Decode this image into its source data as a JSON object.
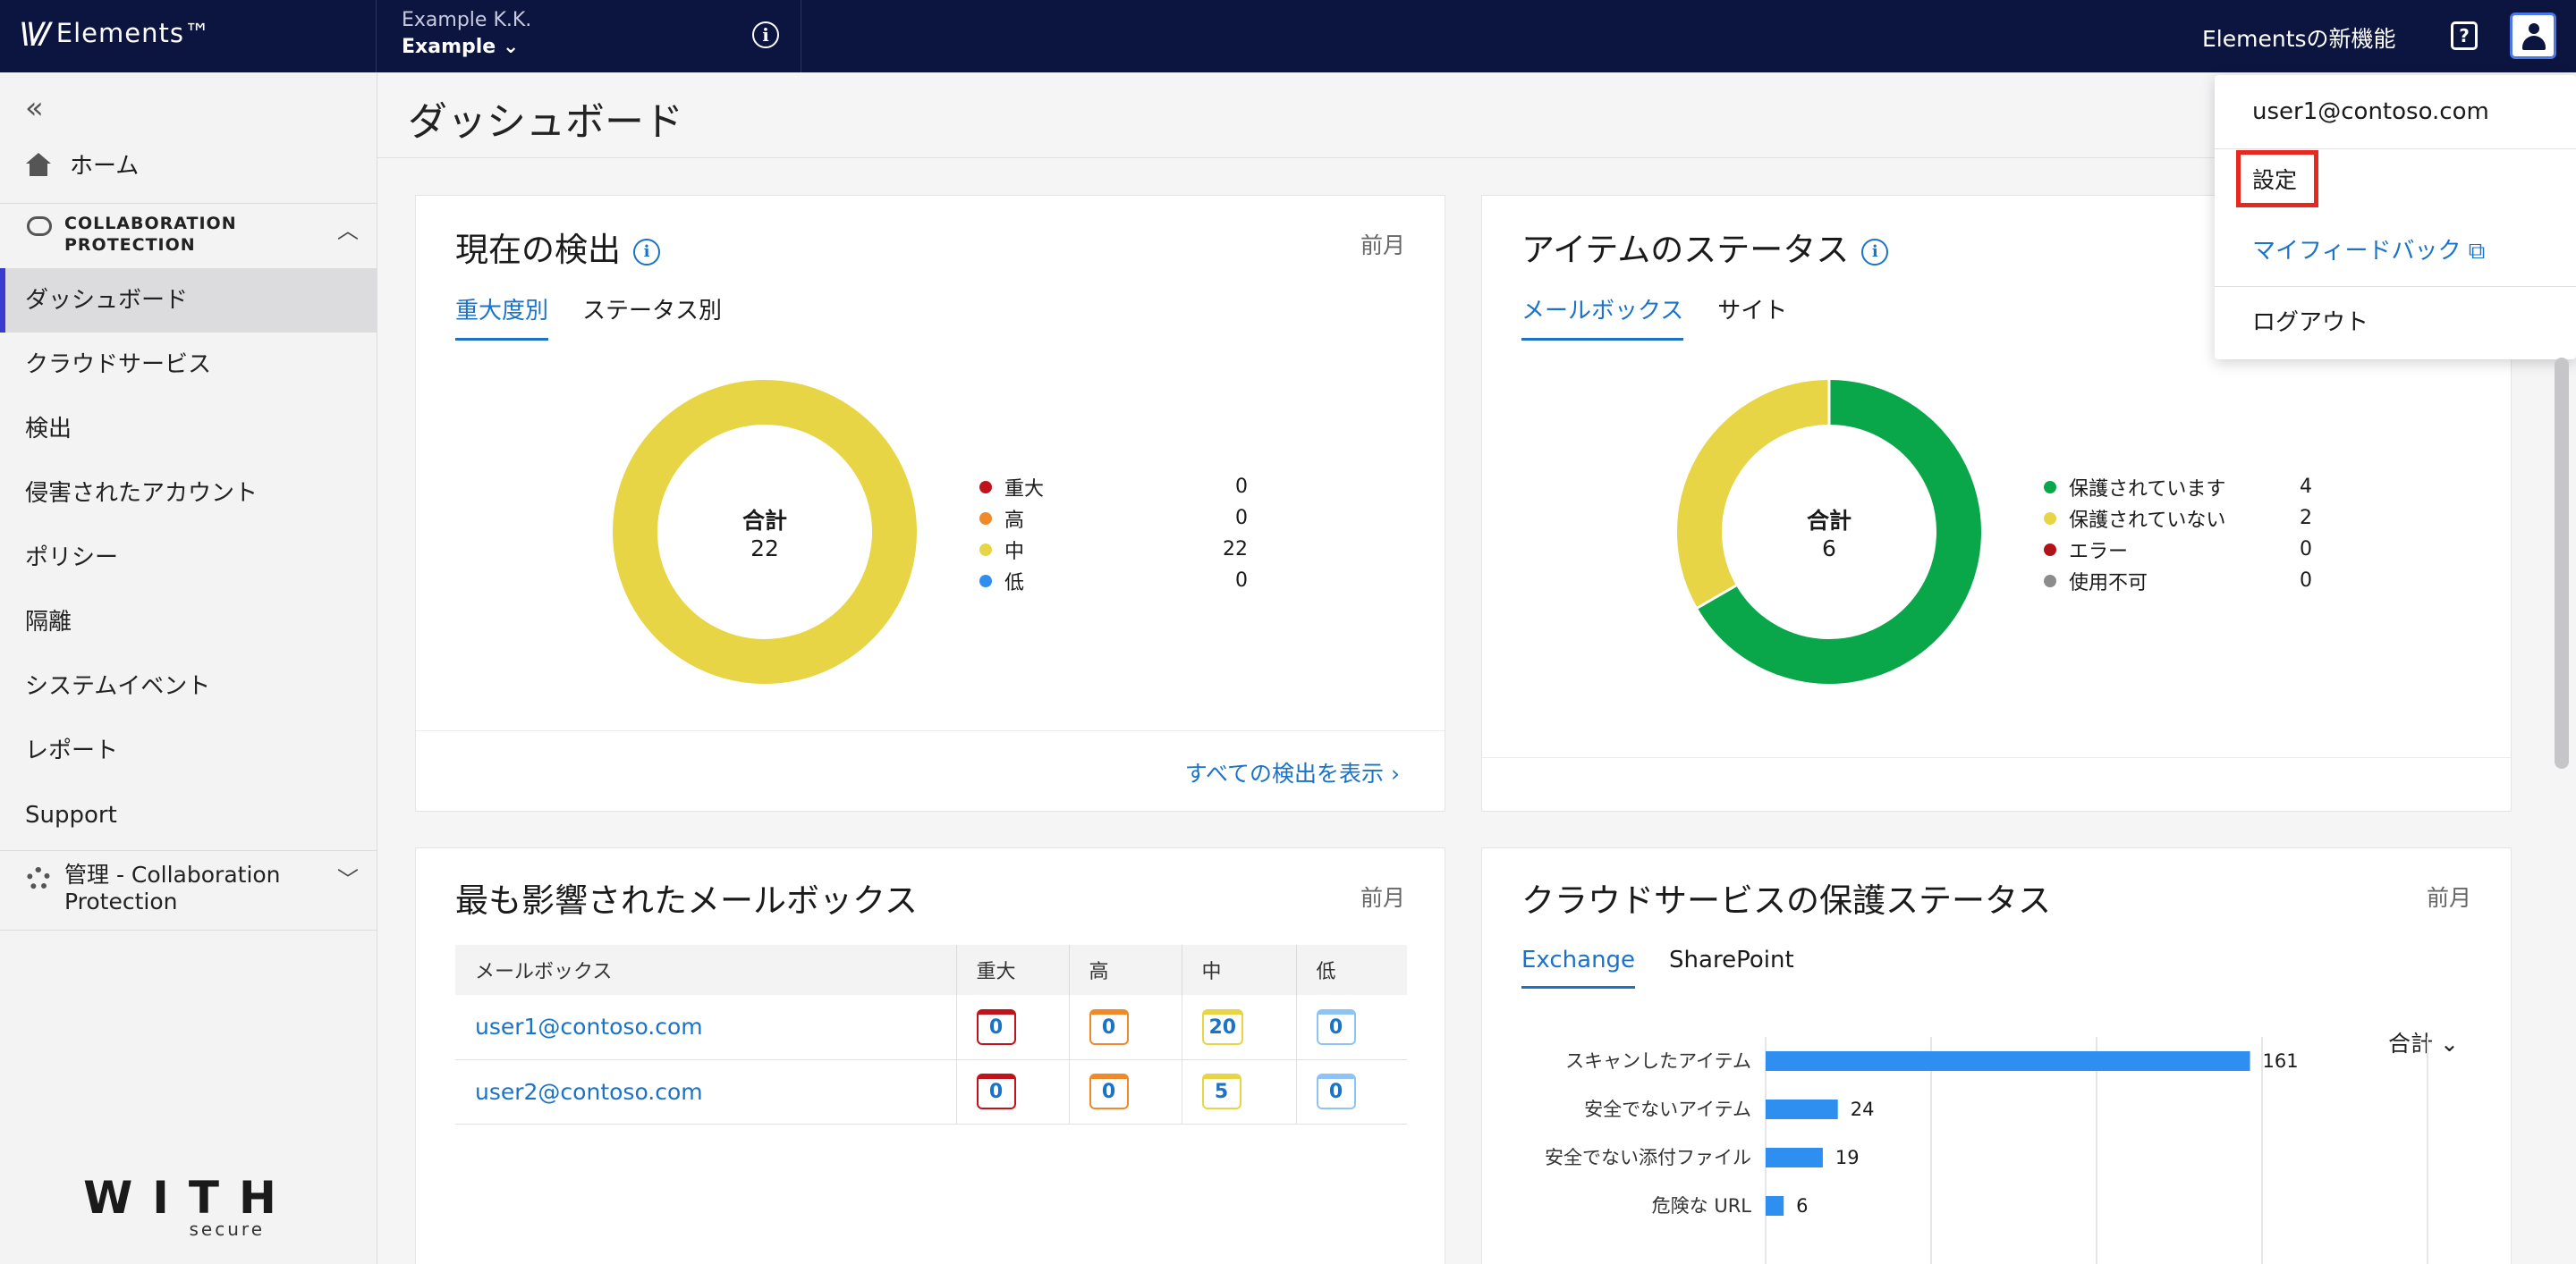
{
  "topbar": {
    "brand": "Elements™",
    "org_name": "Example K.K.",
    "org_selected": "Example",
    "whats_new": "Elementsの新機能"
  },
  "sidebar": {
    "home": "ホーム",
    "section_title_line1": "COLLABORATION",
    "section_title_line2": "PROTECTION",
    "items": [
      "ダッシュボード",
      "クラウドサービス",
      "検出",
      "侵害されたアカウント",
      "ポリシー",
      "隔離",
      "システムイベント",
      "レポート",
      "Support"
    ],
    "admin_line1": "管理 - Collaboration",
    "admin_line2": "Protection",
    "logo_main": "WITH",
    "logo_sub": "secure"
  },
  "page": {
    "title": "ダッシュボード"
  },
  "detections": {
    "title": "現在の検出",
    "period": "前月",
    "tabs": [
      "重大度別",
      "ステータス別"
    ],
    "total_label": "合計",
    "total": "22",
    "legend": [
      {
        "name": "重大",
        "value": "0",
        "color": "#c0141c"
      },
      {
        "name": "高",
        "value": "0",
        "color": "#ef8a2a"
      },
      {
        "name": "中",
        "value": "22",
        "color": "#e8d545"
      },
      {
        "name": "低",
        "value": "0",
        "color": "#2e8ff0"
      }
    ],
    "link": "すべての検出を表示 ›"
  },
  "item_status": {
    "title": "アイテムのステータス",
    "tabs": [
      "メールボックス",
      "サイト"
    ],
    "total_label": "合計",
    "total": "6",
    "legend": [
      {
        "name": "保護されています",
        "value": "4",
        "color": "#0aa64a"
      },
      {
        "name": "保護されていない",
        "value": "2",
        "color": "#e8d545"
      },
      {
        "name": "エラー",
        "value": "0",
        "color": "#b2121a"
      },
      {
        "name": "使用不可",
        "value": "0",
        "color": "#8c8c8c"
      }
    ]
  },
  "mailboxes": {
    "title": "最も影響されたメールボックス",
    "period": "前月",
    "headers": [
      "メールボックス",
      "重大",
      "高",
      "中",
      "低"
    ],
    "rows": [
      {
        "email": "user1@contoso.com",
        "critical": "0",
        "high": "0",
        "medium": "20",
        "low": "0"
      },
      {
        "email": "user2@contoso.com",
        "critical": "0",
        "high": "0",
        "medium": "5",
        "low": "0"
      }
    ]
  },
  "cloud": {
    "title": "クラウドサービスの保護ステータス",
    "period": "前月",
    "tabs": [
      "Exchange",
      "SharePoint"
    ],
    "selector": "合計"
  },
  "chart_data": {
    "type": "bar",
    "orientation": "horizontal",
    "categories": [
      "スキャンしたアイテム",
      "安全でないアイテム",
      "安全でない添付ファイル",
      "危険な URL"
    ],
    "values": [
      161,
      24,
      19,
      6
    ],
    "color": "#2e8ff0",
    "xlim": [
      0,
      220
    ],
    "grid": true
  },
  "user_menu": {
    "email": "user1@contoso.com",
    "settings": "設定",
    "feedback": "マイフィードバック",
    "logout": "ログアウト"
  }
}
